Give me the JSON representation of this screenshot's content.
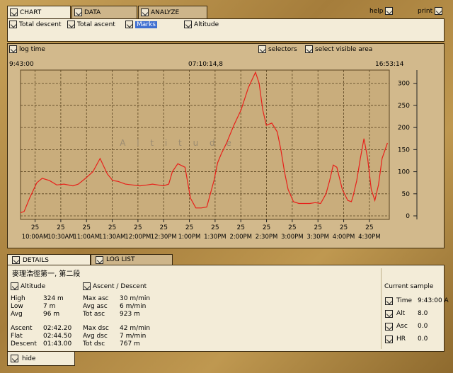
{
  "tabs": {
    "chart": "CHART",
    "data": "DATA",
    "analyze": "ANALYZE"
  },
  "top_actions": {
    "help": "help",
    "print": "print"
  },
  "options": {
    "total_descent": "Total descent",
    "total_ascent": "Total ascent",
    "marks": "Marks",
    "altitude": "Altitude"
  },
  "chart_tools": {
    "log_time": "log time",
    "selectors": "selectors",
    "select_visible_area": "select visible area"
  },
  "time_range": {
    "start": "9:43:00",
    "cursor": "07:10:14,8",
    "end": "16:53:14"
  },
  "chart_data": {
    "type": "line",
    "watermark": "A l t i t u d e",
    "y_ticks": [
      0,
      50,
      100,
      150,
      200,
      250,
      300
    ],
    "ylim": [
      -8,
      330
    ],
    "x_tick_top_labels": [
      "25",
      "25",
      "25",
      "25",
      "25",
      "25",
      "25",
      "25",
      "25",
      "25",
      "25",
      "25",
      "25",
      "25"
    ],
    "x_tick_bottom_labels": [
      "10:00AM",
      "10:30AM",
      "11:00AM",
      "11:30AM",
      "12:00PM",
      "12:30PM",
      "1:00PM",
      "1:30PM",
      "2:00PM",
      "2:30PM",
      "3:00PM",
      "3:30PM",
      "4:00PM",
      "4:30PM"
    ],
    "x_hours": [
      0,
      0.1,
      0.25,
      0.45,
      0.6,
      0.8,
      1.0,
      1.2,
      1.45,
      1.6,
      1.8,
      2.0,
      2.2,
      2.4,
      2.55,
      2.7,
      2.9,
      3.1,
      3.3,
      3.5,
      3.65,
      3.8,
      3.95,
      4.1,
      4.2,
      4.35,
      4.55,
      4.7,
      4.85,
      5.0,
      5.15,
      5.25,
      5.35,
      5.45,
      5.55,
      5.7,
      5.9,
      6.1,
      6.3,
      6.5,
      6.6,
      6.7,
      6.8,
      6.95,
      7.1,
      7.2,
      7.3,
      7.4,
      7.55,
      7.7,
      7.85,
      8.0,
      8.15,
      8.3,
      8.45,
      8.55,
      8.65,
      8.75,
      8.9,
      9.05,
      9.15,
      9.2,
      9.3,
      9.4,
      9.5,
      9.6,
      9.7,
      9.8,
      9.9,
      10.0,
      10.15
    ],
    "y_values": [
      7,
      10,
      40,
      75,
      85,
      80,
      70,
      72,
      68,
      72,
      85,
      100,
      130,
      95,
      80,
      78,
      72,
      70,
      68,
      70,
      72,
      70,
      68,
      72,
      100,
      118,
      110,
      40,
      18,
      18,
      20,
      50,
      80,
      120,
      140,
      165,
      205,
      240,
      290,
      325,
      300,
      240,
      205,
      210,
      190,
      150,
      100,
      60,
      32,
      28,
      28,
      28,
      30,
      28,
      50,
      80,
      115,
      110,
      60,
      35,
      32,
      45,
      80,
      130,
      175,
      130,
      60,
      35,
      70,
      130,
      165
    ],
    "hours_range": [
      9.717,
      16.887
    ],
    "tick_hours": [
      10.0,
      10.5,
      11.0,
      11.5,
      12.0,
      12.5,
      13.0,
      13.5,
      14.0,
      14.5,
      15.0,
      15.5,
      16.0,
      16.5
    ]
  },
  "bottom_tabs": {
    "details": "DETAILS",
    "log_list": "LOG LIST"
  },
  "details": {
    "route_name": "麥理浩徑第一, 第二段",
    "altitude_header": "Altitude",
    "ascent_descent_header": "Ascent / Descent",
    "stats_left": [
      {
        "label": "High",
        "value": "324 m"
      },
      {
        "label": "Low",
        "value": "7 m"
      },
      {
        "label": "Avg",
        "value": "96 m"
      }
    ],
    "stats_mid": [
      {
        "label": "Max asc",
        "value": "30 m/min"
      },
      {
        "label": "Avg asc",
        "value": "6 m/min"
      },
      {
        "label": "Tot asc",
        "value": "923 m"
      }
    ],
    "times_left": [
      {
        "label": "Ascent",
        "value": "02:42.20"
      },
      {
        "label": "Flat",
        "value": "02:44.50"
      },
      {
        "label": "Descent",
        "value": "01:43.00"
      }
    ],
    "times_mid": [
      {
        "label": "Max dsc",
        "value": "42 m/min"
      },
      {
        "label": "Avg dsc",
        "value": "7 m/min"
      },
      {
        "label": "Tot dsc",
        "value": "767 m"
      }
    ],
    "current_sample": {
      "title": "Current sample",
      "rows": [
        {
          "label": "Time",
          "value": "9:43:00 A",
          "icon": "clock-icon"
        },
        {
          "label": "Alt",
          "value": "8.0",
          "icon": "altitude-icon"
        },
        {
          "label": "Asc",
          "value": "0.0",
          "icon": "ascent-icon"
        },
        {
          "label": "HR",
          "value": "0.0",
          "icon": "heart-icon"
        }
      ]
    }
  },
  "hide_label": "hide",
  "colors": {
    "accent": "#3f6fd0",
    "line": "#e8201a",
    "plot_bg": "#c9ad7c",
    "panel": "#f3ecd8"
  }
}
